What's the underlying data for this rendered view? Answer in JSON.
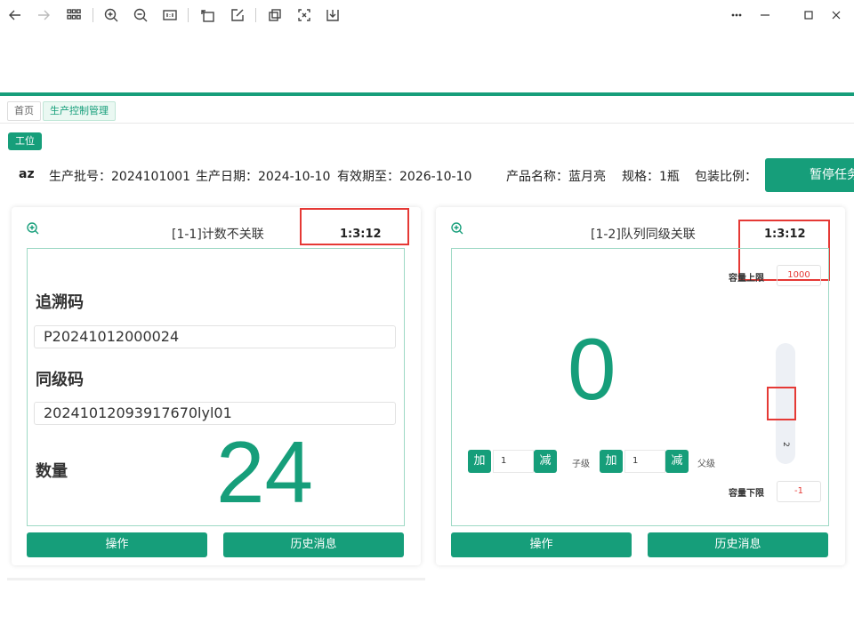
{
  "toolbar": {
    "icons": [
      "back-icon",
      "forward-icon",
      "grid-icon",
      "zoom-in-icon",
      "zoom-out-icon",
      "actual-size-icon",
      "rotate-icon",
      "edit-icon",
      "crop-icon",
      "fit-icon",
      "download-icon",
      "more-icon",
      "minimize-icon",
      "maximize-icon",
      "close-icon"
    ]
  },
  "tabs": [
    {
      "label": "首页"
    },
    {
      "label": "生产控制管理"
    }
  ],
  "station_tag": "工位",
  "info": {
    "code": "az",
    "batch": "生产批号：2024101001",
    "date": "生产日期：2024-10-10",
    "expiry": "有效期至：2026-10-10",
    "product": "产品名称：蓝月亮",
    "spec": "规格：1瓶",
    "ratio_label": "包装比例："
  },
  "pause_button": "暂停任务",
  "cards": [
    {
      "title": "[1-1]计数不关联",
      "ratio": "1:3:12",
      "trace_label": "追溯码",
      "trace_value": "P20241012000024",
      "sibling_label": "同级码",
      "sibling_value": "20241012093917670lyl01",
      "count_label": "数量",
      "count": "24",
      "btn_operate": "操作",
      "btn_history": "历史消息"
    },
    {
      "title": "[1-2]队列同级关联",
      "ratio": "1:3:12",
      "cap_upper_label": "容量上限",
      "cap_upper": "1000",
      "cap_lower_label": "容量下限",
      "cap_lower": "-1",
      "count": "0",
      "slider_value": "2",
      "add_label": "加",
      "sub_label": "减",
      "child_value": "1",
      "child_label": "子级",
      "parent_value": "1",
      "parent_label": "父级",
      "btn_operate": "操作",
      "btn_history": "历史消息"
    }
  ],
  "colors": {
    "brand": "#169e7a",
    "highlight": "#e53935"
  }
}
